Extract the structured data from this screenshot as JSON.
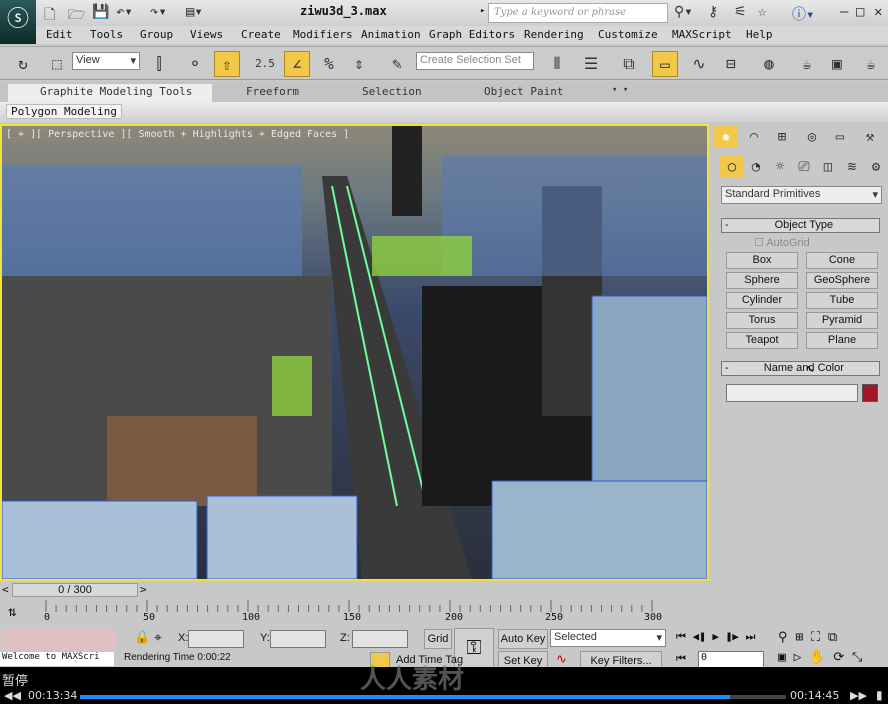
{
  "window": {
    "title": "ziwu3d_3.max",
    "search_placeholder": "Type a keyword or phrase"
  },
  "menu": [
    "Edit",
    "Tools",
    "Group",
    "Views",
    "Create",
    "Modifiers",
    "Animation",
    "Graph Editors",
    "Rendering",
    "Customize",
    "MAXScript",
    "Help"
  ],
  "toolbar": {
    "ref_coord": "View",
    "selection_set": "Create Selection Set",
    "snap_value": "2.5"
  },
  "ribbon": {
    "tabs": [
      "Graphite Modeling Tools",
      "Freeform",
      "Selection",
      "Object Paint"
    ],
    "panel": "Polygon Modeling"
  },
  "viewport": {
    "label": "[ + ][ Perspective ][ Smooth + Highlights + Edged Faces ]"
  },
  "command_panel": {
    "category": "Standard Primitives",
    "object_type": "Object Type",
    "autogrid": "AutoGrid",
    "buttons": [
      "Box",
      "Cone",
      "Sphere",
      "GeoSphere",
      "Cylinder",
      "Tube",
      "Torus",
      "Pyramid",
      "Teapot",
      "Plane"
    ],
    "name_color": "Name and Color",
    "name_value": "",
    "color": "#a01828"
  },
  "timeline": {
    "frame": "0 / 300",
    "ticks": [
      "0",
      "50",
      "100",
      "150",
      "200",
      "250",
      "300"
    ]
  },
  "status": {
    "x_label": "X:",
    "y_label": "Y:",
    "z_label": "Z:",
    "grid": "Grid",
    "auto_key": "Auto Key",
    "set_key": "Set Key",
    "key_mode": "Selected",
    "key_filters": "Key Filters...",
    "frame_field": "0",
    "listener": "Welcome to MAXScri",
    "prompt": "Rendering Time  0:00:22",
    "add_time_tag": "Add Time Tag"
  },
  "video": {
    "state": "暂停",
    "current": "00:13:34",
    "total": "00:14:45",
    "progress": 0.92,
    "watermark": "人人素材"
  }
}
